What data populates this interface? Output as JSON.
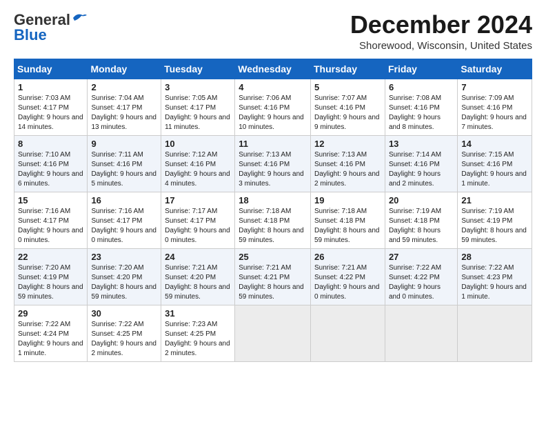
{
  "header": {
    "logo_line1": "General",
    "logo_line2": "Blue",
    "month_title": "December 2024",
    "location": "Shorewood, Wisconsin, United States"
  },
  "days_of_week": [
    "Sunday",
    "Monday",
    "Tuesday",
    "Wednesday",
    "Thursday",
    "Friday",
    "Saturday"
  ],
  "weeks": [
    [
      {
        "day": "1",
        "sunrise": "7:03 AM",
        "sunset": "4:17 PM",
        "daylight": "9 hours and 14 minutes."
      },
      {
        "day": "2",
        "sunrise": "7:04 AM",
        "sunset": "4:17 PM",
        "daylight": "9 hours and 13 minutes."
      },
      {
        "day": "3",
        "sunrise": "7:05 AM",
        "sunset": "4:17 PM",
        "daylight": "9 hours and 11 minutes."
      },
      {
        "day": "4",
        "sunrise": "7:06 AM",
        "sunset": "4:16 PM",
        "daylight": "9 hours and 10 minutes."
      },
      {
        "day": "5",
        "sunrise": "7:07 AM",
        "sunset": "4:16 PM",
        "daylight": "9 hours and 9 minutes."
      },
      {
        "day": "6",
        "sunrise": "7:08 AM",
        "sunset": "4:16 PM",
        "daylight": "9 hours and 8 minutes."
      },
      {
        "day": "7",
        "sunrise": "7:09 AM",
        "sunset": "4:16 PM",
        "daylight": "9 hours and 7 minutes."
      }
    ],
    [
      {
        "day": "8",
        "sunrise": "7:10 AM",
        "sunset": "4:16 PM",
        "daylight": "9 hours and 6 minutes."
      },
      {
        "day": "9",
        "sunrise": "7:11 AM",
        "sunset": "4:16 PM",
        "daylight": "9 hours and 5 minutes."
      },
      {
        "day": "10",
        "sunrise": "7:12 AM",
        "sunset": "4:16 PM",
        "daylight": "9 hours and 4 minutes."
      },
      {
        "day": "11",
        "sunrise": "7:13 AM",
        "sunset": "4:16 PM",
        "daylight": "9 hours and 3 minutes."
      },
      {
        "day": "12",
        "sunrise": "7:13 AM",
        "sunset": "4:16 PM",
        "daylight": "9 hours and 2 minutes."
      },
      {
        "day": "13",
        "sunrise": "7:14 AM",
        "sunset": "4:16 PM",
        "daylight": "9 hours and 2 minutes."
      },
      {
        "day": "14",
        "sunrise": "7:15 AM",
        "sunset": "4:16 PM",
        "daylight": "9 hours and 1 minute."
      }
    ],
    [
      {
        "day": "15",
        "sunrise": "7:16 AM",
        "sunset": "4:17 PM",
        "daylight": "9 hours and 0 minutes."
      },
      {
        "day": "16",
        "sunrise": "7:16 AM",
        "sunset": "4:17 PM",
        "daylight": "9 hours and 0 minutes."
      },
      {
        "day": "17",
        "sunrise": "7:17 AM",
        "sunset": "4:17 PM",
        "daylight": "9 hours and 0 minutes."
      },
      {
        "day": "18",
        "sunrise": "7:18 AM",
        "sunset": "4:18 PM",
        "daylight": "8 hours and 59 minutes."
      },
      {
        "day": "19",
        "sunrise": "7:18 AM",
        "sunset": "4:18 PM",
        "daylight": "8 hours and 59 minutes."
      },
      {
        "day": "20",
        "sunrise": "7:19 AM",
        "sunset": "4:18 PM",
        "daylight": "8 hours and 59 minutes."
      },
      {
        "day": "21",
        "sunrise": "7:19 AM",
        "sunset": "4:19 PM",
        "daylight": "8 hours and 59 minutes."
      }
    ],
    [
      {
        "day": "22",
        "sunrise": "7:20 AM",
        "sunset": "4:19 PM",
        "daylight": "8 hours and 59 minutes."
      },
      {
        "day": "23",
        "sunrise": "7:20 AM",
        "sunset": "4:20 PM",
        "daylight": "8 hours and 59 minutes."
      },
      {
        "day": "24",
        "sunrise": "7:21 AM",
        "sunset": "4:20 PM",
        "daylight": "8 hours and 59 minutes."
      },
      {
        "day": "25",
        "sunrise": "7:21 AM",
        "sunset": "4:21 PM",
        "daylight": "8 hours and 59 minutes."
      },
      {
        "day": "26",
        "sunrise": "7:21 AM",
        "sunset": "4:22 PM",
        "daylight": "9 hours and 0 minutes."
      },
      {
        "day": "27",
        "sunrise": "7:22 AM",
        "sunset": "4:22 PM",
        "daylight": "9 hours and 0 minutes."
      },
      {
        "day": "28",
        "sunrise": "7:22 AM",
        "sunset": "4:23 PM",
        "daylight": "9 hours and 1 minute."
      }
    ],
    [
      {
        "day": "29",
        "sunrise": "7:22 AM",
        "sunset": "4:24 PM",
        "daylight": "9 hours and 1 minute."
      },
      {
        "day": "30",
        "sunrise": "7:22 AM",
        "sunset": "4:25 PM",
        "daylight": "9 hours and 2 minutes."
      },
      {
        "day": "31",
        "sunrise": "7:23 AM",
        "sunset": "4:25 PM",
        "daylight": "9 hours and 2 minutes."
      },
      null,
      null,
      null,
      null
    ]
  ],
  "labels": {
    "sunrise": "Sunrise:",
    "sunset": "Sunset:",
    "daylight": "Daylight:"
  }
}
